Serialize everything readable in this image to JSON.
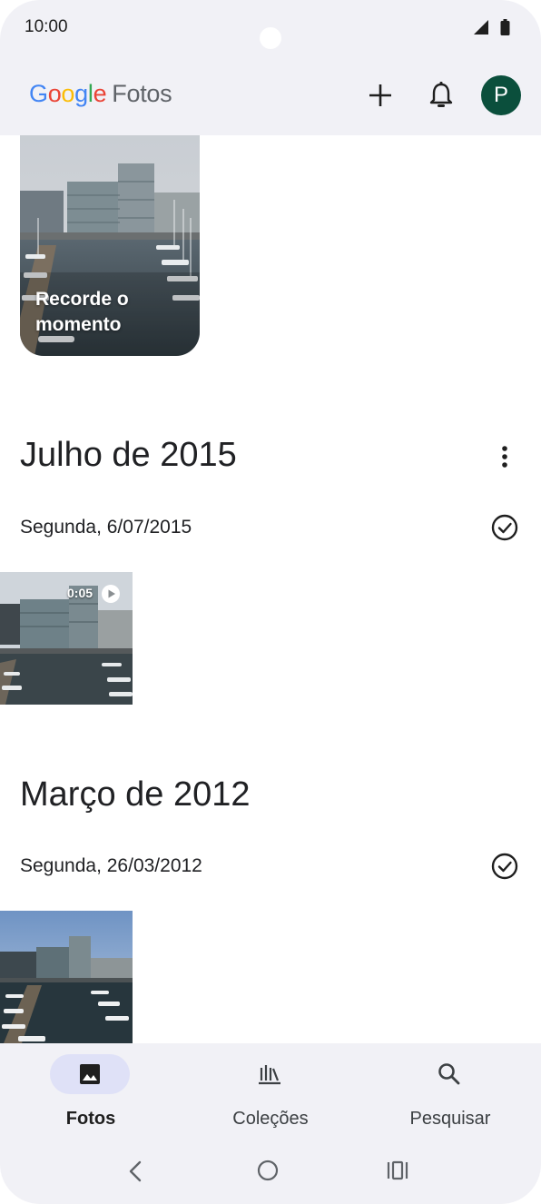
{
  "status_bar": {
    "time": "10:00",
    "icons": [
      "signal-icon",
      "battery-icon"
    ]
  },
  "app_bar": {
    "logo": {
      "g1": "G",
      "o1": "o",
      "o2": "o",
      "g2": "g",
      "l": "l",
      "e": "e",
      "product": "Fotos"
    },
    "actions": [
      "add-icon",
      "bell-icon"
    ],
    "avatar_letter": "P",
    "avatar_color": "#0b4f3c"
  },
  "memory_card": {
    "label": "Recorde o momento"
  },
  "sections": [
    {
      "month": "Julho de 2015",
      "day": "Segunda, 6/07/2015",
      "video_duration": "0:05"
    },
    {
      "month": "Março de 2012",
      "day": "Segunda, 26/03/2012"
    }
  ],
  "bottom_nav": {
    "items": [
      {
        "label": "Fotos",
        "icon": "photo-icon",
        "active": true
      },
      {
        "label": "Coleções",
        "icon": "collections-icon",
        "active": false
      },
      {
        "label": "Pesquisar",
        "icon": "search-icon",
        "active": false
      }
    ]
  },
  "system_nav": [
    "back-icon",
    "home-icon",
    "recents-icon"
  ],
  "colors": {
    "bar_background": "#f1f1f6",
    "active_pill": "#dfe1f7",
    "avatar": "#0b4f3c"
  }
}
